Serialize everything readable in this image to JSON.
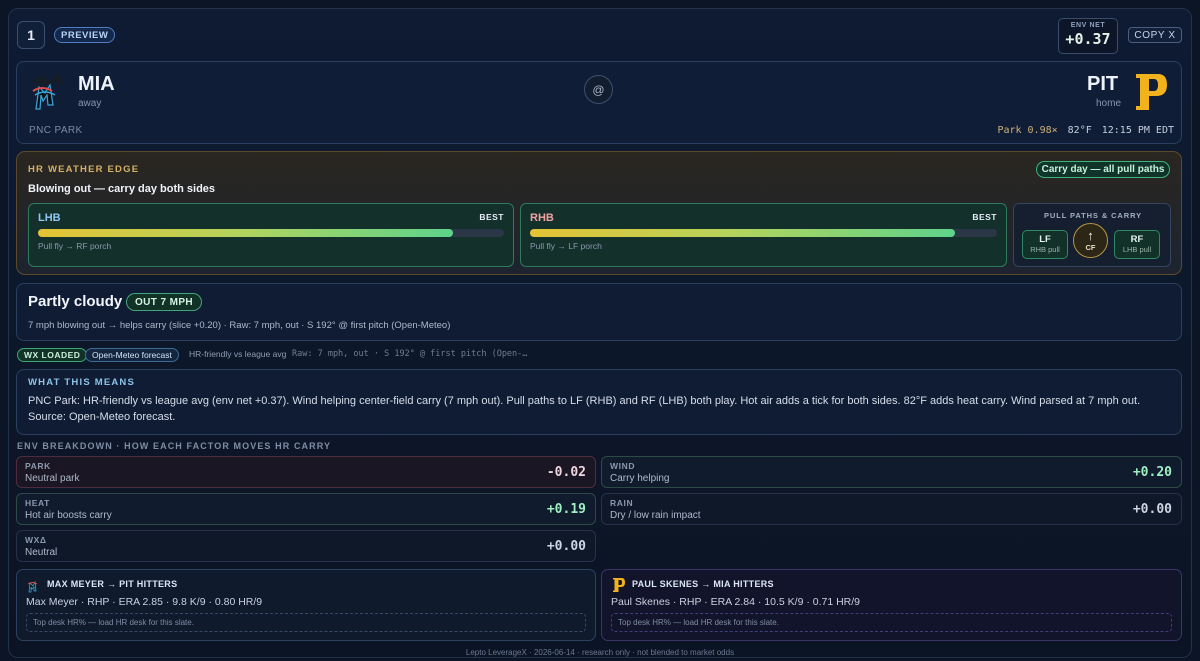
{
  "header": {
    "rank": "1",
    "status_pill": "PREVIEW",
    "env_net_label": "ENV NET",
    "env_net_value": "+0.37",
    "copy_label": "COPY X"
  },
  "matchup": {
    "away": {
      "code": "MIA",
      "role": "away",
      "logo_icon": "marlins-logo"
    },
    "home": {
      "code": "PIT",
      "role": "home",
      "logo_icon": "pirates-logo"
    },
    "at_symbol": "@",
    "venue": "PNC PARK",
    "park_factor": "Park 0.98×",
    "temperature": "82°F",
    "first_pitch": "12:15 PM EDT"
  },
  "edge": {
    "label": "HR WEATHER EDGE",
    "headline": "Blowing out — carry day both sides",
    "carry_pill": "Carry day — all pull paths",
    "lhb": {
      "title": "LHB",
      "badge": "BEST",
      "strength": 0.89,
      "note": "Pull fly → RF porch"
    },
    "rhb": {
      "title": "RHB",
      "badge": "BEST",
      "strength": 0.91,
      "note": "Pull fly → LF porch"
    },
    "pull": {
      "label": "PULL PATHS & CARRY",
      "lf": {
        "title": "LF",
        "sub": "RHB pull"
      },
      "cf": {
        "arrow": "↑",
        "title": "CF"
      },
      "rf": {
        "title": "RF",
        "sub": "LHB pull"
      }
    },
    "colors": {
      "accent": "#d6b067",
      "good": "#3fb37c"
    }
  },
  "conditions": {
    "title": "Partly cloudy",
    "wind_pill": "OUT 7 MPH",
    "detail": "7 mph blowing out → helps carry (slice +0.20) · Raw: 7 mph, out · S 192° @ first pitch (Open-Meteo)"
  },
  "status": {
    "wx_loaded": "WX LOADED",
    "source": "Open-Meteo forecast",
    "friendly": "HR-friendly vs league avg",
    "raw": "Raw: 7 mph, out · S 192° @ first pitch (Open-…"
  },
  "means": {
    "label": "WHAT THIS MEANS",
    "text": "PNC Park: HR-friendly vs league avg (env net +0.37). Wind helping center-field carry (7 mph out). Pull paths to LF (RHB) and RF (LHB) both play. Hot air adds a tick for both sides. 82°F adds heat carry. Wind parsed at 7 mph out. Source: Open-Meteo forecast."
  },
  "breakdown": {
    "label": "ENV BREAKDOWN · HOW EACH FACTOR MOVES HR CARRY",
    "park": {
      "name": "PARK",
      "desc": "Neutral park",
      "value": "-0.02",
      "color": "#f0d6de"
    },
    "wind": {
      "name": "WIND",
      "desc": "Carry helping",
      "value": "+0.20",
      "color": "#9ef0c2"
    },
    "heat": {
      "name": "HEAT",
      "desc": "Hot air boosts carry",
      "value": "+0.19",
      "color": "#9ef0c2"
    },
    "rain": {
      "name": "RAIN",
      "desc": "Dry / low rain impact",
      "value": "+0.00",
      "color": "#cdd5e2"
    },
    "wxd": {
      "name": "WXΔ",
      "desc": "Neutral",
      "value": "+0.00",
      "color": "#cdd5e2"
    }
  },
  "pitchers": {
    "left": {
      "head": "MAX MEYER → PIT HITTERS",
      "line": "Max Meyer · RHP · ERA 2.85 · 9.8 K/9 · 0.80 HR/9",
      "desk": "Top desk HR% — load HR desk for this slate."
    },
    "right": {
      "head": "PAUL SKENES → MIA HITTERS",
      "line": "Paul Skenes · RHP · ERA 2.84 · 10.5 K/9 · 0.71 HR/9",
      "desk": "Top desk HR% — load HR desk for this slate."
    }
  },
  "footer": "Lepto LeverageX · 2026-06-14 · research only · not blended to market odds"
}
